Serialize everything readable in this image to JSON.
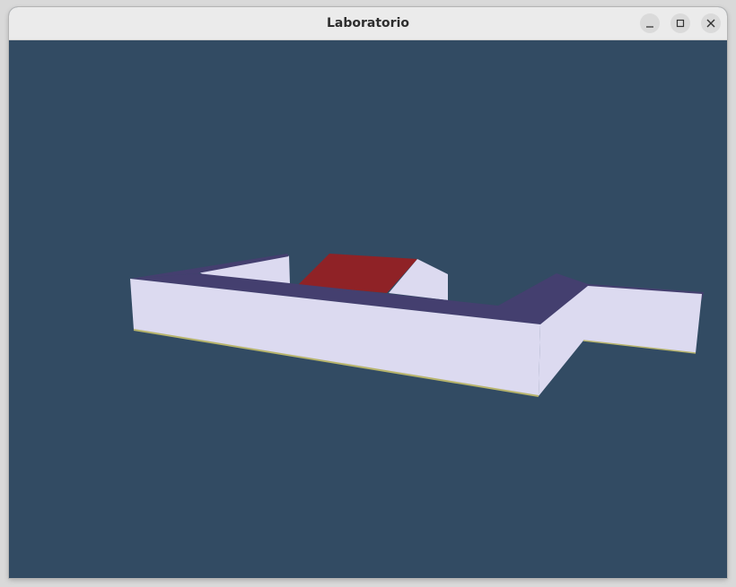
{
  "window": {
    "title": "Laboratorio",
    "controls": {
      "minimize_icon": "minimize-icon",
      "maximize_icon": "maximize-icon",
      "close_icon": "close-icon"
    }
  },
  "scene": {
    "background_color": "#324b63",
    "wall_front_color": "#dcdaf0",
    "wall_top_color": "#443f6f",
    "floor_tile_color": "#8f2226",
    "edge_line_color": "#b7b46c"
  }
}
